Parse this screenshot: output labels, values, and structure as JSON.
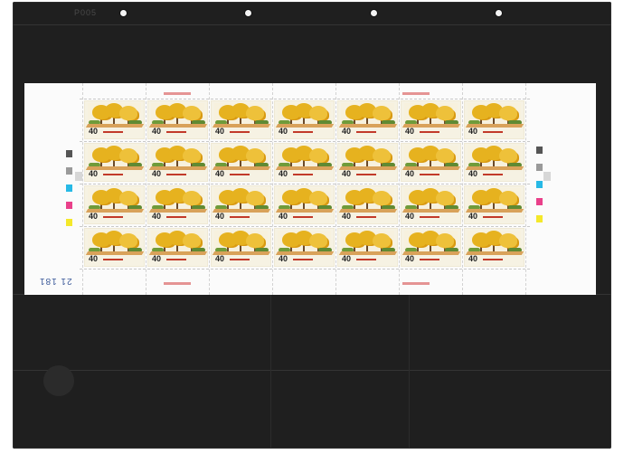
{
  "album": {
    "code": "P005"
  },
  "sheet": {
    "rows": 4,
    "cols": 7,
    "denomination": "40",
    "number_label": "21 181",
    "color_bars": [
      "#555555",
      "#9a9a9a",
      "#27b9e6",
      "#e9408a",
      "#f4e82a"
    ]
  },
  "colors": {
    "tree": "#e6b21f",
    "ground": "#d9a25a",
    "inscription": "#c23a2a"
  }
}
